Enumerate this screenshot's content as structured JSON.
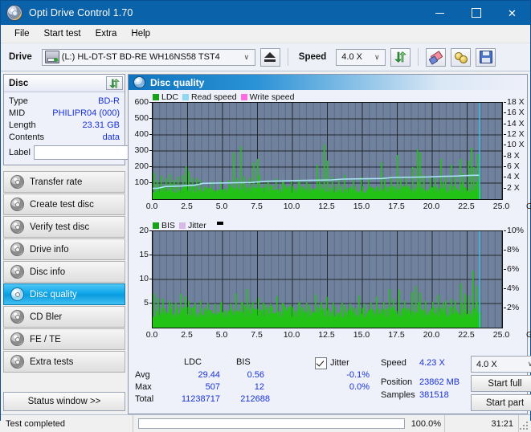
{
  "window": {
    "title": "Opti Drive Control 1.70",
    "icon": "disc-icon",
    "minimize": "–",
    "maximize": "□",
    "close": "✕"
  },
  "menu": {
    "items": [
      "File",
      "Start test",
      "Extra",
      "Help"
    ]
  },
  "toolbar": {
    "drive_label": "Drive",
    "drive_value": "(L:)  HL-DT-ST BD-RE  WH16NS58 TST4",
    "eject_icon": "eject-icon",
    "speed_label": "Speed",
    "speed_value": "4.0 X",
    "refresh_icon": "refresh-icon",
    "erase_icon": "eraser-icon",
    "gold_icon": "gold-discs-icon",
    "save_icon": "floppy-save-icon",
    "arrow": "∨"
  },
  "disc": {
    "panel_title": "Disc",
    "refresh_icon": "refresh-icon",
    "rows": [
      {
        "key": "Type",
        "value": "BD-R"
      },
      {
        "key": "MID",
        "value": "PHILIPR04 (000)"
      },
      {
        "key": "Length",
        "value": "23.31 GB"
      },
      {
        "key": "Contents",
        "value": "data"
      }
    ],
    "label_key": "Label",
    "label_value": "",
    "label_placeholder": "",
    "disc_icon": "disc-icon"
  },
  "nav": {
    "items": [
      {
        "label": "Transfer rate",
        "active": false
      },
      {
        "label": "Create test disc",
        "active": false
      },
      {
        "label": "Verify test disc",
        "active": false
      },
      {
        "label": "Drive info",
        "active": false
      },
      {
        "label": "Disc info",
        "active": false
      },
      {
        "label": "Disc quality",
        "active": true
      },
      {
        "label": "CD Bler",
        "active": false
      },
      {
        "label": "FE / TE",
        "active": false
      },
      {
        "label": "Extra tests",
        "active": false
      }
    ],
    "status_window": "Status window >>"
  },
  "main": {
    "title": "Disc quality",
    "icon": "disc-icon"
  },
  "stats": {
    "col_ldc": "LDC",
    "col_bis": "BIS",
    "jitter_label": "Jitter",
    "jitter_checked": true,
    "rows": [
      {
        "key": "Avg",
        "ldc": "29.44",
        "bis": "0.56",
        "jitter": "-0.1%"
      },
      {
        "key": "Max",
        "ldc": "507",
        "bis": "12",
        "jitter": "0.0%"
      },
      {
        "key": "Total",
        "ldc": "11238717",
        "bis": "212688",
        "jitter": ""
      }
    ],
    "speed_key": "Speed",
    "speed_value": "4.23 X",
    "position_key": "Position",
    "position_value": "23862 MB",
    "samples_key": "Samples",
    "samples_value": "381518",
    "speed_select": "4.0 X",
    "speed_select_arrow": "∨",
    "start_full": "Start full",
    "start_part": "Start part"
  },
  "statusbar": {
    "message": "Test completed",
    "percent_label": "100.0%",
    "percent_value": 100,
    "elapsed": "31:21"
  },
  "colors": {
    "title_bar": "#0a62ab",
    "plot_bg": "#6f819c",
    "ldc_green": "#22c316",
    "read_speed": "#8fd8f2",
    "write_speed": "#ff6ee0",
    "jitter": "#d8b8e8",
    "value_blue": "#1832d8",
    "progress_green": "#14b814",
    "accent_cyan": "#3fc2f3"
  },
  "chart_data": [
    {
      "id": "ldc-chart",
      "type": "bar",
      "title": "",
      "xlabel": "GB",
      "ylabel": "",
      "xlim": [
        0,
        25
      ],
      "ylim": [
        0,
        600
      ],
      "y2lim": [
        0,
        18
      ],
      "y2label": "X",
      "yticks": [
        100,
        200,
        300,
        400,
        500,
        600
      ],
      "y2ticks": [
        2,
        4,
        6,
        8,
        10,
        12,
        14,
        16,
        18
      ],
      "xticks": [
        0.0,
        2.5,
        5.0,
        7.5,
        10.0,
        12.5,
        15.0,
        17.5,
        20.0,
        22.5,
        25.0
      ],
      "xtick_labels": [
        "0.0",
        "2.5",
        "5.0",
        "7.5",
        "10.0",
        "12.5",
        "15.0",
        "17.5",
        "20.0",
        "22.5",
        "25.0"
      ],
      "grid": true,
      "legend": [
        {
          "name": "LDC",
          "color": "#1aa11a"
        },
        {
          "name": "Read speed",
          "color": "#8fd8f2"
        },
        {
          "name": "Write speed",
          "color": "#ff6ee0"
        }
      ],
      "legend_position": "top-left",
      "data_end_x": 23.4,
      "series": [
        {
          "name": "LDC",
          "color": "#22c316",
          "kind": "bars",
          "baseline": 75,
          "noise": 40,
          "spikes": [
            [
              0.05,
              165
            ],
            [
              0.3,
              120
            ],
            [
              0.6,
              145
            ],
            [
              0.9,
              130
            ],
            [
              1.2,
              155
            ],
            [
              1.5,
              120
            ],
            [
              1.8,
              140
            ],
            [
              2.1,
              150
            ],
            [
              2.35,
              205
            ],
            [
              2.5,
              175
            ],
            [
              2.8,
              135
            ],
            [
              3.1,
              130
            ],
            [
              3.4,
              120
            ],
            [
              4.2,
              110
            ],
            [
              4.8,
              115
            ],
            [
              5.4,
              120
            ],
            [
              5.75,
              290
            ],
            [
              5.95,
              130
            ],
            [
              6.25,
              330
            ],
            [
              6.5,
              140
            ],
            [
              6.9,
              135
            ],
            [
              7.2,
              230
            ],
            [
              7.45,
              250
            ],
            [
              7.6,
              150
            ],
            [
              8.2,
              120
            ],
            [
              8.8,
              130
            ],
            [
              9.3,
              120
            ],
            [
              9.9,
              115
            ],
            [
              10.4,
              125
            ],
            [
              11.0,
              120
            ],
            [
              11.7,
              215
            ],
            [
              11.9,
              130
            ],
            [
              12.25,
              340
            ],
            [
              12.45,
              240
            ],
            [
              12.8,
              140
            ],
            [
              13.3,
              130
            ],
            [
              13.7,
              150
            ],
            [
              14.3,
              125
            ],
            [
              14.9,
              140
            ],
            [
              15.4,
              130
            ],
            [
              16.3,
              230
            ],
            [
              16.55,
              135
            ],
            [
              17.0,
              140
            ],
            [
              17.45,
              275
            ],
            [
              17.7,
              130
            ],
            [
              18.1,
              145
            ],
            [
              18.55,
              200
            ],
            [
              18.9,
              310
            ],
            [
              19.1,
              290
            ],
            [
              19.35,
              150
            ],
            [
              19.8,
              140
            ],
            [
              20.2,
              135
            ],
            [
              20.55,
              250
            ],
            [
              20.9,
              145
            ],
            [
              21.3,
              215
            ],
            [
              21.6,
              140
            ],
            [
              21.95,
              250
            ],
            [
              22.2,
              160
            ],
            [
              22.5,
              240
            ],
            [
              22.75,
              320
            ],
            [
              22.95,
              200
            ],
            [
              23.2,
              280
            ],
            [
              23.35,
              160
            ]
          ]
        },
        {
          "name": "Read speed",
          "color": "#a8e2f7",
          "kind": "line",
          "axis": "y2",
          "points": [
            [
              0.0,
              2.0
            ],
            [
              0.4,
              2.05
            ],
            [
              0.9,
              2.35
            ],
            [
              2.0,
              2.45
            ],
            [
              3.0,
              2.6
            ],
            [
              3.6,
              2.95
            ],
            [
              4.5,
              3.0
            ],
            [
              5.6,
              3.05
            ],
            [
              7.0,
              3.1
            ],
            [
              8.2,
              3.35
            ],
            [
              9.3,
              3.4
            ],
            [
              10.6,
              3.5
            ],
            [
              12.0,
              3.55
            ],
            [
              12.8,
              3.6
            ],
            [
              13.6,
              3.75
            ],
            [
              14.8,
              3.8
            ],
            [
              16.4,
              3.85
            ],
            [
              17.2,
              4.05
            ],
            [
              18.6,
              4.1
            ],
            [
              19.8,
              4.15
            ],
            [
              20.6,
              4.25
            ],
            [
              21.6,
              4.3
            ],
            [
              22.4,
              4.4
            ],
            [
              23.0,
              4.45
            ],
            [
              23.35,
              4.45
            ]
          ]
        }
      ],
      "cursor_line": {
        "x": 23.4,
        "color": "#3fc2f3"
      }
    },
    {
      "id": "bis-chart",
      "type": "bar",
      "title": "",
      "xlabel": "GB",
      "ylabel": "",
      "xlim": [
        0,
        25
      ],
      "ylim": [
        0,
        20
      ],
      "y2lim": [
        0,
        10
      ],
      "y2label": "%",
      "yticks": [
        5,
        10,
        15,
        20
      ],
      "y2ticks": [
        2,
        4,
        6,
        8,
        10
      ],
      "y2tick_labels": [
        "2%",
        "4%",
        "6%",
        "8%",
        "10%"
      ],
      "xticks": [
        0.0,
        2.5,
        5.0,
        7.5,
        10.0,
        12.5,
        15.0,
        17.5,
        20.0,
        22.5,
        25.0
      ],
      "xtick_labels": [
        "0.0",
        "2.5",
        "5.0",
        "7.5",
        "10.0",
        "12.5",
        "15.0",
        "17.5",
        "20.0",
        "22.5",
        "25.0"
      ],
      "grid": true,
      "legend": [
        {
          "name": "BIS",
          "color": "#1aa11a"
        },
        {
          "name": "Jitter",
          "color": "#d8b8e8"
        }
      ],
      "legend_marker": "black-square",
      "legend_position": "top-left",
      "data_end_x": 23.4,
      "series": [
        {
          "name": "BIS",
          "color": "#22c316",
          "kind": "bars",
          "baseline": 4.0,
          "noise": 1.6,
          "spikes": [
            [
              0.05,
              7.0
            ],
            [
              0.35,
              6.2
            ],
            [
              0.7,
              6.0
            ],
            [
              1.15,
              5.6
            ],
            [
              1.6,
              5.2
            ],
            [
              1.95,
              7.0
            ],
            [
              2.3,
              6.5
            ],
            [
              2.55,
              5.6
            ],
            [
              3.0,
              5.2
            ],
            [
              3.4,
              5.6
            ],
            [
              3.9,
              5.1
            ],
            [
              4.4,
              5.0
            ],
            [
              4.9,
              5.4
            ],
            [
              5.5,
              5.0
            ],
            [
              5.9,
              7.1
            ],
            [
              6.4,
              5.4
            ],
            [
              6.75,
              8.0
            ],
            [
              7.1,
              5.4
            ],
            [
              7.5,
              6.2
            ],
            [
              7.9,
              5.2
            ],
            [
              8.4,
              5.0
            ],
            [
              8.85,
              6.5
            ],
            [
              9.3,
              5.0
            ],
            [
              9.8,
              4.8
            ],
            [
              10.4,
              5.0
            ],
            [
              11.0,
              5.2
            ],
            [
              11.6,
              6.8
            ],
            [
              12.0,
              5.4
            ],
            [
              12.4,
              6.4
            ],
            [
              12.9,
              5.2
            ],
            [
              13.5,
              5.2
            ],
            [
              14.1,
              5.0
            ],
            [
              14.7,
              6.6
            ],
            [
              15.1,
              5.0
            ],
            [
              15.6,
              5.2
            ],
            [
              16.0,
              6.4
            ],
            [
              16.5,
              5.4
            ],
            [
              16.9,
              8.0
            ],
            [
              17.2,
              6.0
            ],
            [
              17.6,
              7.9
            ],
            [
              18.0,
              5.6
            ],
            [
              18.5,
              7.4
            ],
            [
              18.8,
              8.6
            ],
            [
              19.1,
              7.2
            ],
            [
              19.5,
              5.6
            ],
            [
              20.0,
              5.4
            ],
            [
              20.4,
              6.8
            ],
            [
              20.9,
              5.6
            ],
            [
              21.3,
              6.0
            ],
            [
              21.6,
              5.6
            ],
            [
              22.0,
              9.2
            ],
            [
              22.3,
              7.0
            ],
            [
              22.6,
              6.6
            ],
            [
              22.9,
              11.8
            ],
            [
              23.15,
              8.6
            ],
            [
              23.35,
              5.6
            ]
          ]
        }
      ],
      "cursor_line": {
        "x": 23.4,
        "color": "#3fc2f3"
      }
    }
  ]
}
